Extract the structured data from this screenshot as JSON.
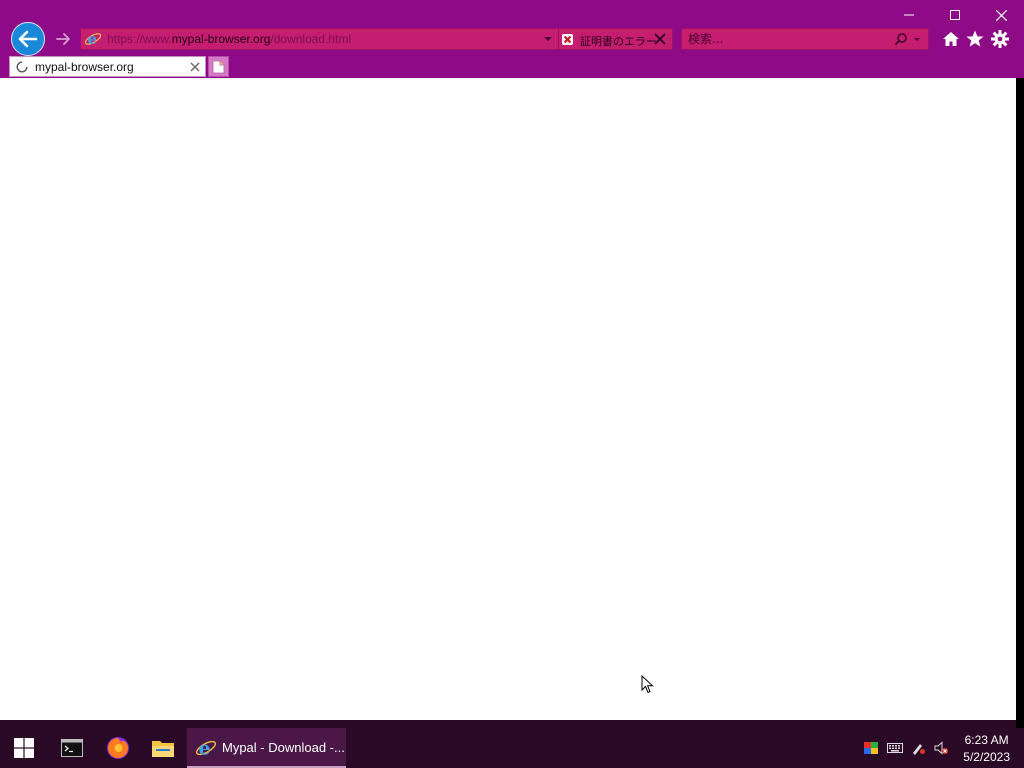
{
  "browser": {
    "address": {
      "prefix": "https://www.",
      "host": "mypal-browser.org",
      "suffix": "/download.html"
    },
    "cert_error_label": "証明書のエラー",
    "search_placeholder": "検索...",
    "tabs": [
      {
        "title": "mypal-browser.org",
        "loading": true
      }
    ],
    "accent_color": "#8e0a86"
  },
  "taskbar": {
    "active_window_label": "Mypal - Download -...",
    "clock": {
      "time": "6:23 AM",
      "date": "5/2/2023"
    }
  }
}
